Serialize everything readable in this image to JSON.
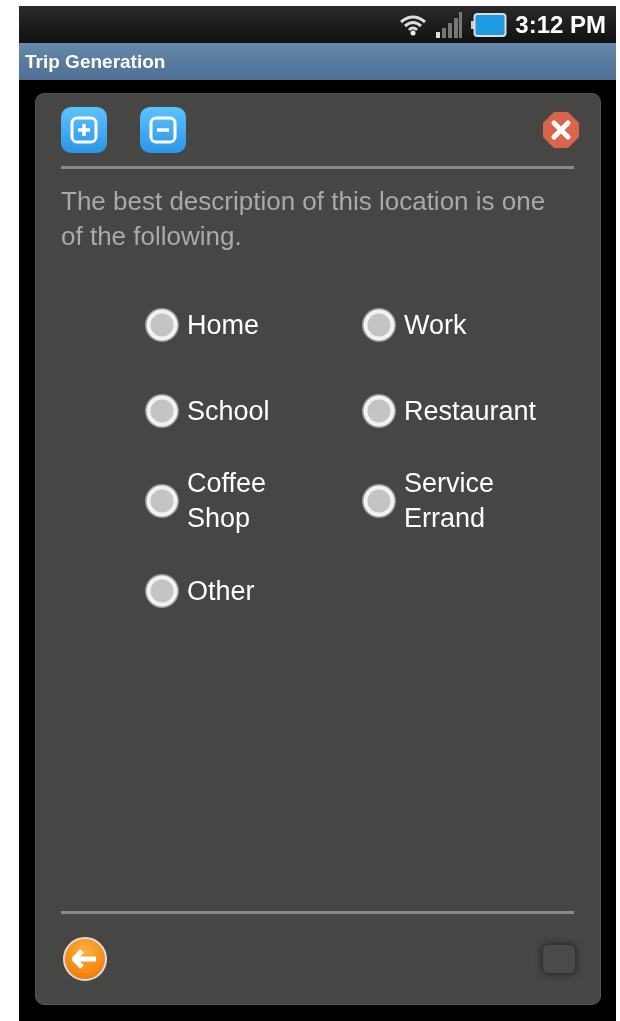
{
  "status_bar": {
    "time": "3:12 PM"
  },
  "app_bar": {
    "title": "Trip Generation"
  },
  "prompt": "The best description of this location is one of the following.",
  "options": [
    {
      "label": "Home",
      "selected": false
    },
    {
      "label": "Work",
      "selected": false
    },
    {
      "label": "School",
      "selected": false
    },
    {
      "label": "Restaurant",
      "selected": false
    },
    {
      "label": "Coffee Shop",
      "selected": false
    },
    {
      "label": "Service Errand",
      "selected": false
    },
    {
      "label": "Other",
      "selected": false
    }
  ]
}
